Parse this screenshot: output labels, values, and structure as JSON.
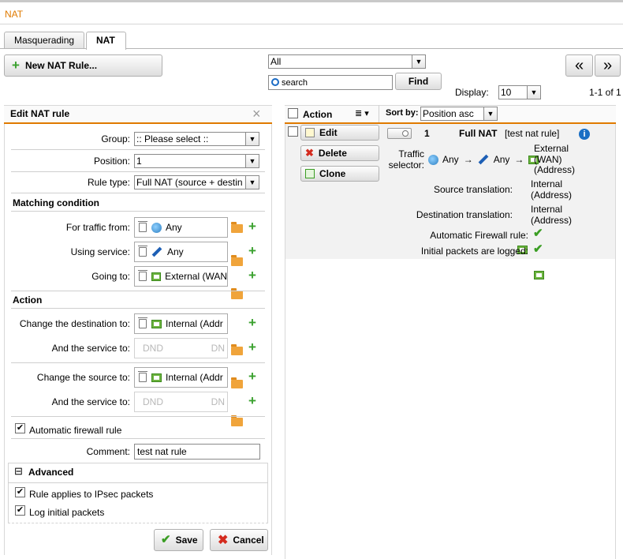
{
  "app": {
    "title": "NAT"
  },
  "tabs": [
    {
      "label": "Masquerading"
    },
    {
      "label": "NAT"
    }
  ],
  "toolbar": {
    "new_rule_label": "New NAT Rule...",
    "filter_value": "All",
    "search_placeholder": "search",
    "find_label": "Find",
    "display_label": "Display:",
    "display_value": "10",
    "pagination_info": "1-1 of 1",
    "prev_label": "«",
    "next_label": "»"
  },
  "edit_panel": {
    "title": "Edit NAT rule",
    "group_label": "Group:",
    "group_value": ":: Please select ::",
    "position_label": "Position:",
    "position_value": "1",
    "rule_type_label": "Rule type:",
    "rule_type_value": "Full NAT (source + destin",
    "matching_heading": "Matching condition",
    "traffic_from_label": "For traffic from:",
    "traffic_from_value": "Any",
    "using_service_label": "Using service:",
    "using_service_value": "Any",
    "going_to_label": "Going to:",
    "going_to_value": "External (WAN",
    "action_heading": "Action",
    "change_dest_label": "Change the destination to:",
    "change_dest_value": "Internal (Addr",
    "dest_service_label": "And the service to:",
    "dest_service_placeholder": "DND",
    "dest_service_placeholder2": "DN",
    "change_source_label": "Change the source to:",
    "change_source_value": "Internal (Addr",
    "source_service_label": "And the service to:",
    "source_service_placeholder": "DND",
    "source_service_placeholder2": "DN",
    "auto_fw_label": "Automatic firewall rule",
    "comment_label": "Comment:",
    "comment_value": "test nat rule",
    "advanced_heading": "Advanced",
    "advanced_toggle": "⊟",
    "ipsec_label": "Rule applies to IPsec packets",
    "log_label": "Log initial packets",
    "save_label": "Save",
    "cancel_label": "Cancel",
    "close_glyph": "×"
  },
  "table": {
    "action_header": "Action",
    "sort_label": "Sort by:",
    "sort_value": "Position asc",
    "edit_label": "Edit",
    "delete_label": "Delete",
    "clone_label": "Clone",
    "rule_number": "1",
    "rule_type": "Full NAT",
    "rule_comment": "[test nat rule]",
    "traffic_selector_label_1": "Traffic",
    "traffic_selector_label_2": "selector:",
    "ts_from": "Any",
    "ts_service": "Any",
    "ts_to_1": "External",
    "ts_to_2": "(WAN)",
    "ts_to_3": "(Address)",
    "arrow": "→",
    "source_translation_label": "Source translation:",
    "source_translation_value_1": "Internal",
    "source_translation_value_2": "(Address)",
    "dest_translation_label": "Destination translation:",
    "dest_translation_value_1": "Internal",
    "dest_translation_value_2": "(Address)",
    "auto_fw_label": "Automatic Firewall rule:",
    "logged_label": "Initial packets are logged:"
  },
  "colors": {
    "accent": "#e07a00",
    "green": "#3a9d23",
    "info": "#1a6fc4",
    "red": "#d42b1e"
  }
}
